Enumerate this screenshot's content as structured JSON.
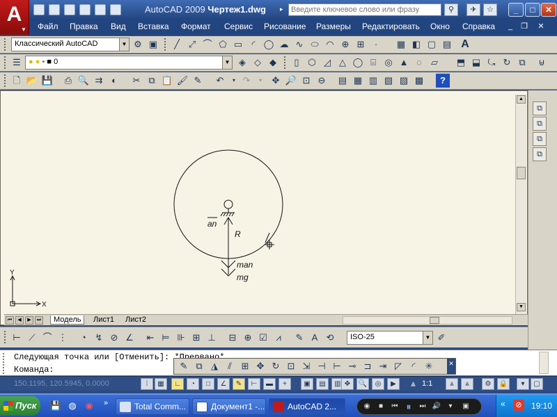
{
  "app": {
    "logo_letter": "A",
    "title_app": "AutoCAD 2009",
    "title_doc": "Чертеж1.dwg",
    "search_placeholder": "Введите ключевое слово или фразу"
  },
  "menu": {
    "items": [
      "Файл",
      "Правка",
      "Вид",
      "Вставка",
      "Формат",
      "Сервис",
      "Рисование",
      "Размеры",
      "Редактировать",
      "Окно",
      "Справка"
    ]
  },
  "toolbars": {
    "workspace_combo": "Классический AutoCAD",
    "layer_combo": "0",
    "dimstyle_combo": "ISO-25"
  },
  "drawing": {
    "labels": {
      "an": "an",
      "r": "R",
      "man": "man",
      "mg": "mg",
      "axis_x": "X",
      "axis_y": "Y"
    }
  },
  "tabs": [
    "Модель",
    "Лист1",
    "Лист2"
  ],
  "command": {
    "history": "Следующая точка или [Отменить]: *Прервано*",
    "prompt": "Команда:"
  },
  "status": {
    "coords": "150.1195, 120.5945, 0.0000",
    "scale": "1:1"
  },
  "taskbar": {
    "start_label": "Пуск",
    "tasks": [
      "Total Comm...",
      "Документ1 -...",
      "AutoCAD 2..."
    ],
    "clock": "19:10"
  },
  "colors": {
    "drawing_bg": "#f7f4e6",
    "title_bg": "#22457f",
    "taskbar_bg": "#1f4fbc"
  }
}
